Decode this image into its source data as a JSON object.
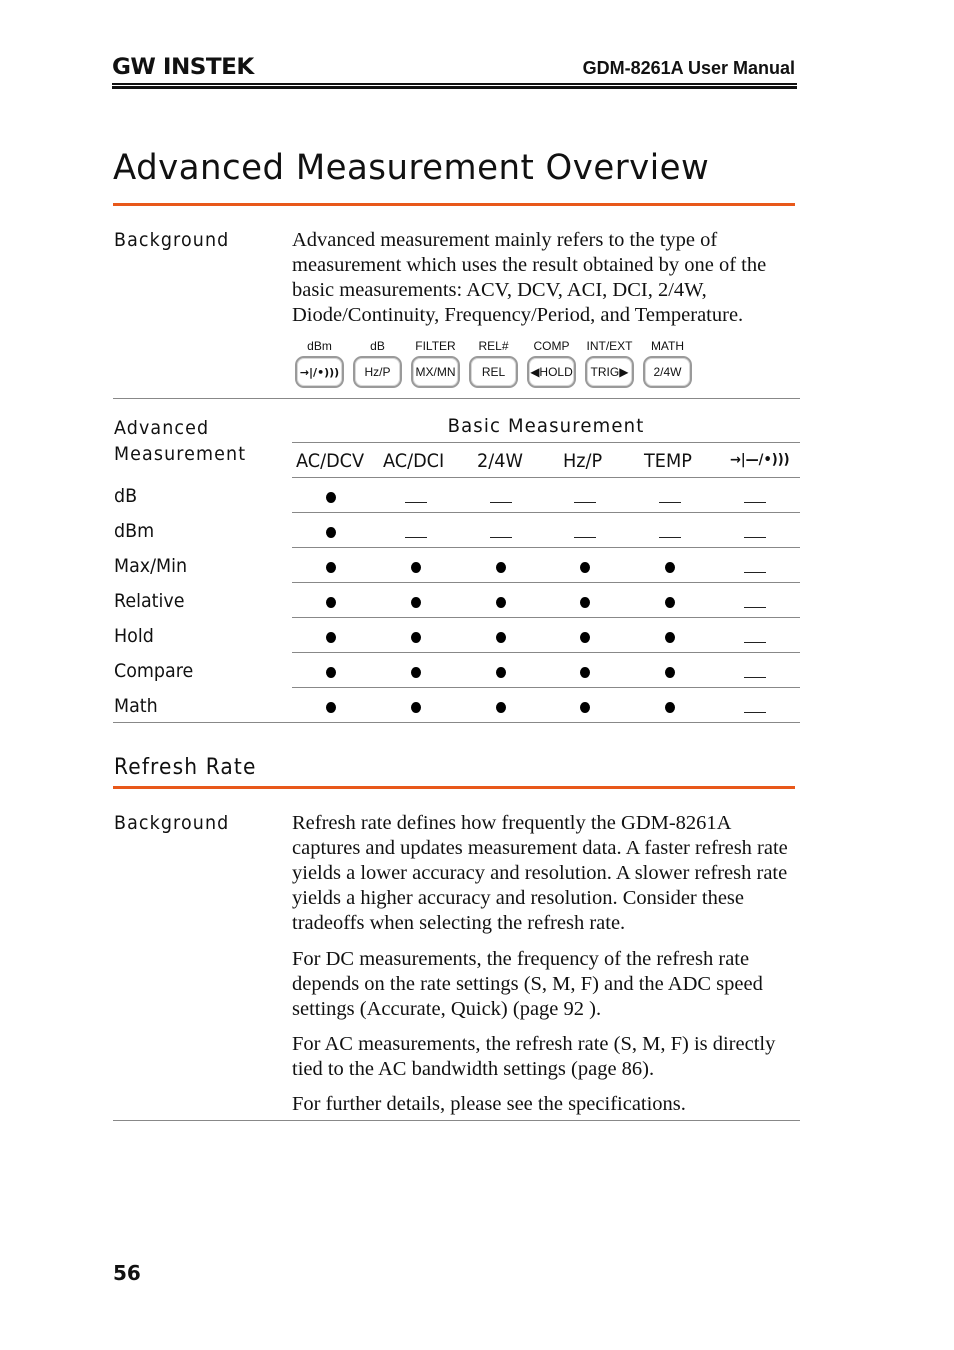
{
  "header": {
    "logo": "GW INSTEK",
    "manual_title": "GDM-8261A User Manual"
  },
  "section1": {
    "title": "Advanced Measurement Overview",
    "background_label": "Background",
    "background_text": "Advanced measurement mainly refers to the type of measurement which uses the result obtained by one of the basic measurements: ACV, DCV, ACI, DCI, 2/4W, Diode/Continuity, Frequency/Period, and Temperature.",
    "keys": [
      {
        "shift_label": "dBm",
        "key_label": "→|—/•)))",
        "icon": "diode-continuity-icon"
      },
      {
        "shift_label": "dB",
        "key_label": "Hz/P"
      },
      {
        "shift_label": "FILTER",
        "key_label": "MX/MN"
      },
      {
        "shift_label": "REL#",
        "key_label": "REL"
      },
      {
        "shift_label": "COMP",
        "key_label": "◀HOLD"
      },
      {
        "shift_label": "INT/EXT",
        "key_label": "TRIG▶"
      },
      {
        "shift_label": "MATH",
        "key_label": "2/4W"
      }
    ],
    "table": {
      "row_header_label": "Advanced Measurement",
      "group_header": "Basic Measurement",
      "columns": [
        "AC/DCV",
        "AC/DCI",
        "2/4W",
        "Hz/P",
        "TEMP",
        "→|—/•)))"
      ],
      "rows": [
        {
          "label": "dB",
          "cells": [
            "supported",
            "unsupported",
            "unsupported",
            "unsupported",
            "unsupported",
            "unsupported"
          ]
        },
        {
          "label": "dBm",
          "cells": [
            "supported",
            "unsupported",
            "unsupported",
            "unsupported",
            "unsupported",
            "unsupported"
          ]
        },
        {
          "label": "Max/Min",
          "cells": [
            "supported",
            "supported",
            "supported",
            "supported",
            "supported",
            "unsupported"
          ]
        },
        {
          "label": "Relative",
          "cells": [
            "supported",
            "supported",
            "supported",
            "supported",
            "supported",
            "unsupported"
          ]
        },
        {
          "label": "Hold",
          "cells": [
            "supported",
            "supported",
            "supported",
            "supported",
            "supported",
            "unsupported"
          ]
        },
        {
          "label": "Compare",
          "cells": [
            "supported",
            "supported",
            "supported",
            "supported",
            "supported",
            "unsupported"
          ]
        },
        {
          "label": "Math",
          "cells": [
            "supported",
            "supported",
            "supported",
            "supported",
            "supported",
            "unsupported"
          ]
        }
      ]
    }
  },
  "section2": {
    "title": "Refresh Rate",
    "background_label": "Background",
    "paragraphs": [
      "Refresh rate defines how frequently the GDM-8261A captures and updates measurement data. A faster refresh rate yields a lower accuracy and resolution. A slower refresh rate yields a higher accuracy and resolution. Consider these tradeoffs when selecting the refresh rate.",
      "For DC measurements, the frequency of  the refresh rate depends on the rate settings (S, M, F) and the ADC speed settings (Accurate, Quick) (page 92 ).",
      "For AC measurements, the refresh rate (S, M, F) is directly tied to the AC bandwidth settings (page 86).",
      "For further details, please see the specifications."
    ]
  },
  "footer": {
    "page_number": "56"
  },
  "colors": {
    "accent_rule": "#e8581a",
    "text": "#111111",
    "divider": "#888888"
  }
}
